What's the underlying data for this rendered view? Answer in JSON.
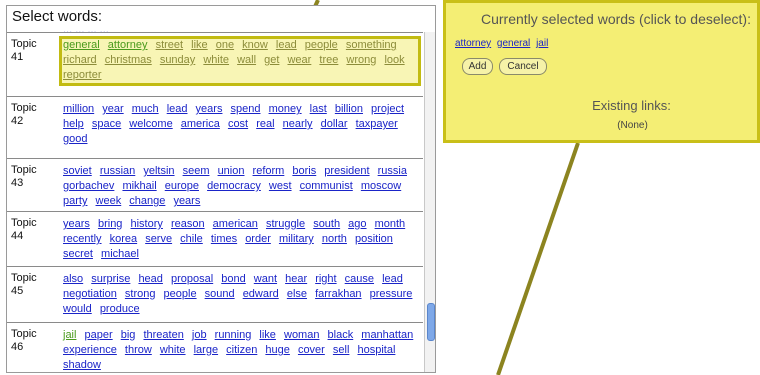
{
  "panel": {
    "title": "Select words:",
    "clipped_top_words": "... ... ... ..."
  },
  "topics": [
    {
      "label": "Topic\n41",
      "words": [
        "general",
        "attorney",
        "street",
        "like",
        "one",
        "know",
        "lead",
        "people",
        "something",
        "richard",
        "christmas",
        "sunday",
        "white",
        "wall",
        "get",
        "wear",
        "tree",
        "wrong",
        "look",
        "reporter"
      ],
      "selected": [
        "general",
        "attorney"
      ],
      "highlighted": true
    },
    {
      "label": "Topic\n42",
      "words": [
        "million",
        "year",
        "much",
        "lead",
        "years",
        "spend",
        "money",
        "last",
        "billion",
        "project",
        "help",
        "space",
        "welcome",
        "america",
        "cost",
        "real",
        "nearly",
        "dollar",
        "taxpayer",
        "good"
      ],
      "selected": [],
      "highlighted": false
    },
    {
      "label": "Topic\n43",
      "words": [
        "soviet",
        "russian",
        "yeltsin",
        "seem",
        "union",
        "reform",
        "boris",
        "president",
        "russia",
        "gorbachev",
        "mikhail",
        "europe",
        "democracy",
        "west",
        "communist",
        "moscow",
        "party",
        "week",
        "change",
        "years"
      ],
      "selected": [],
      "highlighted": false
    },
    {
      "label": "Topic\n44",
      "words": [
        "years",
        "bring",
        "history",
        "reason",
        "american",
        "struggle",
        "south",
        "ago",
        "month",
        "recently",
        "korea",
        "serve",
        "chile",
        "times",
        "order",
        "military",
        "north",
        "position",
        "secret",
        "michael"
      ],
      "selected": [],
      "highlighted": false
    },
    {
      "label": "Topic\n45",
      "words": [
        "also",
        "surprise",
        "head",
        "proposal",
        "bond",
        "want",
        "hear",
        "right",
        "cause",
        "lead",
        "negotiation",
        "strong",
        "people",
        "sound",
        "edward",
        "else",
        "farrakhan",
        "pressure",
        "would",
        "produce"
      ],
      "selected": [],
      "highlighted": false
    },
    {
      "label": "Topic\n46",
      "words": [
        "jail",
        "paper",
        "big",
        "threaten",
        "job",
        "running",
        "like",
        "woman",
        "black",
        "manhattan",
        "experience",
        "throw",
        "white",
        "large",
        "citizen",
        "huge",
        "cover",
        "sell",
        "hospital",
        "shadow"
      ],
      "selected": [
        "jail"
      ],
      "highlighted": false
    }
  ],
  "callout": {
    "title": "Currently selected words (click to deselect):",
    "selected_words": [
      "attorney",
      "general",
      "jail"
    ],
    "add_label": "Add",
    "cancel_label": "Cancel",
    "links_title": "Existing links:",
    "links_value": "(None)"
  },
  "colors": {
    "link": "#1a24c8",
    "selected_word": "#4a9a1c",
    "highlight_fill": "#f4ee74",
    "highlight_border": "#c9bf18",
    "callout_line": "#8c8420"
  }
}
